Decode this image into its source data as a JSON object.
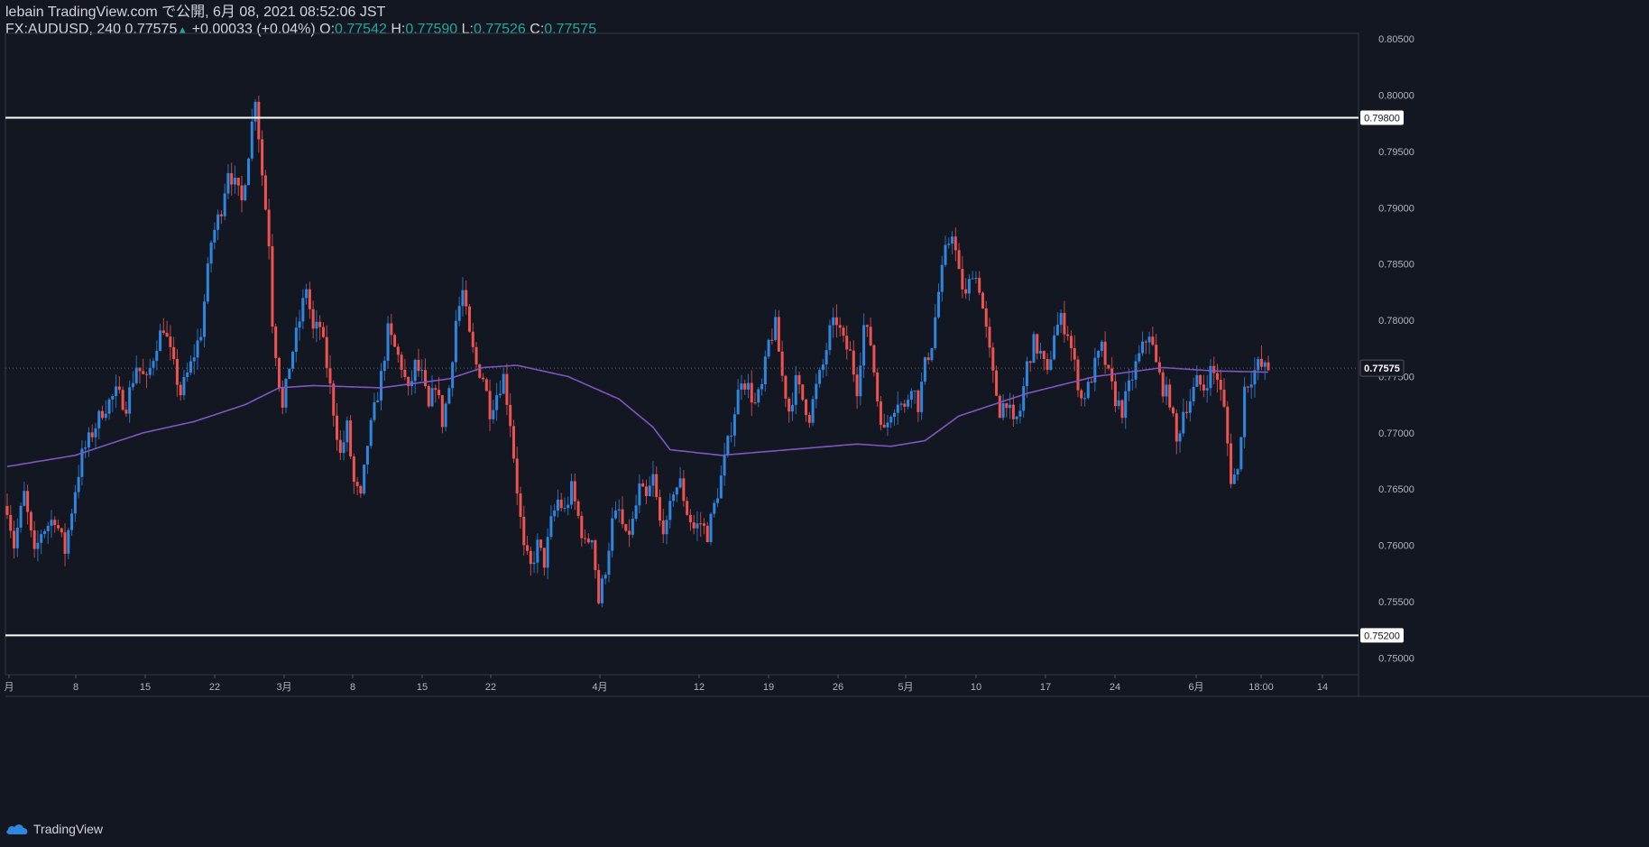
{
  "header": {
    "line1": "lebain TradingView.com で公開, 6月 08, 2021 08:52:06 JST",
    "symbol_interval": "FX:AUDUSD, 240",
    "last": "0.77575",
    "change": "+0.00033 (+0.04%)",
    "o_label": "O:",
    "o": "0.77542",
    "h_label": "H:",
    "h": "0.77590",
    "l_label": "L:",
    "l": "0.77526",
    "c_label": "C:",
    "c": "0.77575"
  },
  "footer": {
    "brand": "TradingView"
  },
  "colors": {
    "background": "#131722",
    "up": "#2e86de",
    "down": "#ef5350",
    "ma": "#7e57c2",
    "level": "#ffffff",
    "positive_text": "#26a69a"
  },
  "chart_data": {
    "type": "candlestick",
    "symbol": "FX:AUDUSD",
    "interval": "240",
    "ylim": [
      0.7485,
      0.8055
    ],
    "y_ticks": [
      "0.80500",
      "0.80000",
      "0.79500",
      "0.79000",
      "0.78500",
      "0.78000",
      "0.77500",
      "0.77000",
      "0.76500",
      "0.76000",
      "0.75500",
      "0.75000"
    ],
    "x_ticks": [
      "月",
      "8",
      "15",
      "22",
      "3月",
      "8",
      "15",
      "22",
      "4月",
      "12",
      "19",
      "26",
      "5月",
      "10",
      "17",
      "24",
      "6月",
      "18:00",
      "14"
    ],
    "horizontal_levels": [
      "0.79800",
      "0.75200"
    ],
    "last_price_label": "0.77575",
    "last_price": 0.77575,
    "price_path": [
      [
        0,
        0.7635
      ],
      [
        2,
        0.76
      ],
      [
        5,
        0.7645
      ],
      [
        8,
        0.759
      ],
      [
        10,
        0.7612
      ],
      [
        14,
        0.7625
      ],
      [
        17,
        0.7595
      ],
      [
        20,
        0.765
      ],
      [
        22,
        0.768
      ],
      [
        25,
        0.77
      ],
      [
        28,
        0.772
      ],
      [
        32,
        0.7735
      ],
      [
        35,
        0.7725
      ],
      [
        38,
        0.776
      ],
      [
        41,
        0.7745
      ],
      [
        44,
        0.778
      ],
      [
        46,
        0.7795
      ],
      [
        48,
        0.777
      ],
      [
        51,
        0.7735
      ],
      [
        54,
        0.776
      ],
      [
        57,
        0.779
      ],
      [
        60,
        0.787
      ],
      [
        63,
        0.79
      ],
      [
        65,
        0.7935
      ],
      [
        67,
        0.792
      ],
      [
        69,
        0.7905
      ],
      [
        71,
        0.795
      ],
      [
        73,
        0.8
      ],
      [
        75,
        0.793
      ],
      [
        77,
        0.787
      ],
      [
        78,
        0.78
      ],
      [
        80,
        0.7745
      ],
      [
        81,
        0.772
      ],
      [
        83,
        0.776
      ],
      [
        86,
        0.78
      ],
      [
        88,
        0.783
      ],
      [
        90,
        0.779
      ],
      [
        92,
        0.7795
      ],
      [
        94,
        0.776
      ],
      [
        96,
        0.772
      ],
      [
        98,
        0.768
      ],
      [
        100,
        0.7705
      ],
      [
        102,
        0.7655
      ],
      [
        104,
        0.764
      ],
      [
        106,
        0.769
      ],
      [
        108,
        0.772
      ],
      [
        110,
        0.775
      ],
      [
        112,
        0.779
      ],
      [
        114,
        0.7775
      ],
      [
        116,
        0.776
      ],
      [
        118,
        0.7735
      ],
      [
        120,
        0.776
      ],
      [
        122,
        0.775
      ],
      [
        124,
        0.772
      ],
      [
        126,
        0.7745
      ],
      [
        128,
        0.771
      ],
      [
        130,
        0.774
      ],
      [
        132,
        0.78
      ],
      [
        134,
        0.7825
      ],
      [
        136,
        0.7785
      ],
      [
        138,
        0.776
      ],
      [
        140,
        0.775
      ],
      [
        142,
        0.772
      ],
      [
        144,
        0.7735
      ],
      [
        146,
        0.775
      ],
      [
        148,
        0.771
      ],
      [
        150,
        0.765
      ],
      [
        152,
        0.7595
      ],
      [
        154,
        0.758
      ],
      [
        156,
        0.76
      ],
      [
        158,
        0.7585
      ],
      [
        160,
        0.762
      ],
      [
        162,
        0.764
      ],
      [
        164,
        0.763
      ],
      [
        166,
        0.765
      ],
      [
        168,
        0.7625
      ],
      [
        170,
        0.76
      ],
      [
        172,
        0.761
      ],
      [
        174,
        0.755
      ],
      [
        176,
        0.758
      ],
      [
        178,
        0.762
      ],
      [
        180,
        0.763
      ],
      [
        182,
        0.7605
      ],
      [
        184,
        0.762
      ],
      [
        186,
        0.765
      ],
      [
        188,
        0.764
      ],
      [
        190,
        0.766
      ],
      [
        192,
        0.762
      ],
      [
        194,
        0.7615
      ],
      [
        196,
        0.765
      ],
      [
        198,
        0.7655
      ],
      [
        200,
        0.763
      ],
      [
        202,
        0.7615
      ],
      [
        204,
        0.762
      ],
      [
        206,
        0.761
      ],
      [
        208,
        0.7635
      ],
      [
        210,
        0.766
      ],
      [
        212,
        0.769
      ],
      [
        214,
        0.772
      ],
      [
        216,
        0.775
      ],
      [
        218,
        0.774
      ],
      [
        220,
        0.7725
      ],
      [
        222,
        0.774
      ],
      [
        224,
        0.778
      ],
      [
        226,
        0.7795
      ],
      [
        228,
        0.775
      ],
      [
        230,
        0.772
      ],
      [
        232,
        0.7745
      ],
      [
        234,
        0.773
      ],
      [
        236,
        0.7715
      ],
      [
        238,
        0.774
      ],
      [
        240,
        0.776
      ],
      [
        242,
        0.779
      ],
      [
        244,
        0.78
      ],
      [
        246,
        0.778
      ],
      [
        248,
        0.777
      ],
      [
        250,
        0.774
      ],
      [
        252,
        0.7795
      ],
      [
        254,
        0.778
      ],
      [
        256,
        0.773
      ],
      [
        258,
        0.77
      ],
      [
        260,
        0.772
      ],
      [
        262,
        0.773
      ],
      [
        264,
        0.772
      ],
      [
        266,
        0.7745
      ],
      [
        268,
        0.7725
      ],
      [
        270,
        0.776
      ],
      [
        272,
        0.778
      ],
      [
        274,
        0.7825
      ],
      [
        276,
        0.786
      ],
      [
        278,
        0.788
      ],
      [
        280,
        0.784
      ],
      [
        282,
        0.782
      ],
      [
        284,
        0.7845
      ],
      [
        286,
        0.783
      ],
      [
        288,
        0.779
      ],
      [
        290,
        0.775
      ],
      [
        292,
        0.772
      ],
      [
        294,
        0.773
      ],
      [
        296,
        0.7705
      ],
      [
        298,
        0.772
      ],
      [
        300,
        0.776
      ],
      [
        302,
        0.778
      ],
      [
        304,
        0.777
      ],
      [
        306,
        0.775
      ],
      [
        308,
        0.779
      ],
      [
        310,
        0.78
      ],
      [
        312,
        0.779
      ],
      [
        314,
        0.776
      ],
      [
        316,
        0.773
      ],
      [
        318,
        0.774
      ],
      [
        320,
        0.776
      ],
      [
        322,
        0.7775
      ],
      [
        324,
        0.775
      ],
      [
        326,
        0.773
      ],
      [
        328,
        0.772
      ],
      [
        330,
        0.774
      ],
      [
        332,
        0.776
      ],
      [
        334,
        0.7775
      ],
      [
        336,
        0.779
      ],
      [
        338,
        0.776
      ],
      [
        340,
        0.774
      ],
      [
        342,
        0.773
      ],
      [
        344,
        0.769
      ],
      [
        346,
        0.772
      ],
      [
        348,
        0.773
      ],
      [
        350,
        0.7745
      ],
      [
        352,
        0.774
      ],
      [
        354,
        0.7755
      ],
      [
        356,
        0.775
      ],
      [
        358,
        0.772
      ],
      [
        360,
        0.766
      ],
      [
        362,
        0.7665
      ],
      [
        364,
        0.774
      ],
      [
        366,
        0.775
      ],
      [
        368,
        0.776
      ],
      [
        370,
        0.7757
      ]
    ],
    "ma_path": [
      [
        0,
        0.767
      ],
      [
        20,
        0.768
      ],
      [
        40,
        0.77
      ],
      [
        55,
        0.771
      ],
      [
        70,
        0.7725
      ],
      [
        80,
        0.774
      ],
      [
        90,
        0.7742
      ],
      [
        110,
        0.774
      ],
      [
        130,
        0.7748
      ],
      [
        140,
        0.7758
      ],
      [
        150,
        0.776
      ],
      [
        165,
        0.775
      ],
      [
        180,
        0.773
      ],
      [
        190,
        0.7705
      ],
      [
        195,
        0.7685
      ],
      [
        210,
        0.768
      ],
      [
        230,
        0.7685
      ],
      [
        250,
        0.769
      ],
      [
        260,
        0.7688
      ],
      [
        270,
        0.7693
      ],
      [
        280,
        0.7715
      ],
      [
        290,
        0.7725
      ],
      [
        300,
        0.7735
      ],
      [
        320,
        0.775
      ],
      [
        340,
        0.7758
      ],
      [
        355,
        0.7755
      ],
      [
        370,
        0.7754
      ]
    ]
  }
}
